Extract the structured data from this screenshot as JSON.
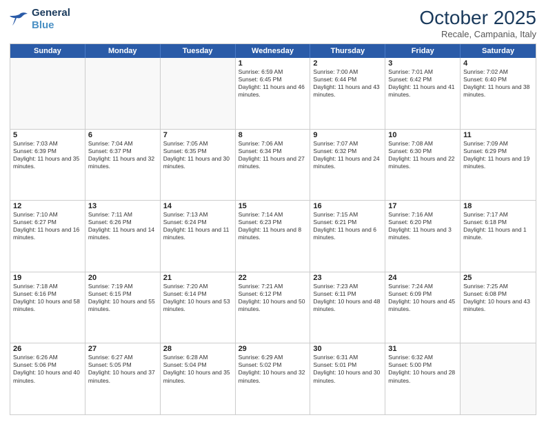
{
  "header": {
    "logo_line1": "General",
    "logo_line2": "Blue",
    "month": "October 2025",
    "location": "Recale, Campania, Italy"
  },
  "days_of_week": [
    "Sunday",
    "Monday",
    "Tuesday",
    "Wednesday",
    "Thursday",
    "Friday",
    "Saturday"
  ],
  "weeks": [
    [
      {
        "day": "",
        "text": ""
      },
      {
        "day": "",
        "text": ""
      },
      {
        "day": "",
        "text": ""
      },
      {
        "day": "1",
        "text": "Sunrise: 6:59 AM\nSunset: 6:45 PM\nDaylight: 11 hours and 46 minutes."
      },
      {
        "day": "2",
        "text": "Sunrise: 7:00 AM\nSunset: 6:44 PM\nDaylight: 11 hours and 43 minutes."
      },
      {
        "day": "3",
        "text": "Sunrise: 7:01 AM\nSunset: 6:42 PM\nDaylight: 11 hours and 41 minutes."
      },
      {
        "day": "4",
        "text": "Sunrise: 7:02 AM\nSunset: 6:40 PM\nDaylight: 11 hours and 38 minutes."
      }
    ],
    [
      {
        "day": "5",
        "text": "Sunrise: 7:03 AM\nSunset: 6:39 PM\nDaylight: 11 hours and 35 minutes."
      },
      {
        "day": "6",
        "text": "Sunrise: 7:04 AM\nSunset: 6:37 PM\nDaylight: 11 hours and 32 minutes."
      },
      {
        "day": "7",
        "text": "Sunrise: 7:05 AM\nSunset: 6:35 PM\nDaylight: 11 hours and 30 minutes."
      },
      {
        "day": "8",
        "text": "Sunrise: 7:06 AM\nSunset: 6:34 PM\nDaylight: 11 hours and 27 minutes."
      },
      {
        "day": "9",
        "text": "Sunrise: 7:07 AM\nSunset: 6:32 PM\nDaylight: 11 hours and 24 minutes."
      },
      {
        "day": "10",
        "text": "Sunrise: 7:08 AM\nSunset: 6:30 PM\nDaylight: 11 hours and 22 minutes."
      },
      {
        "day": "11",
        "text": "Sunrise: 7:09 AM\nSunset: 6:29 PM\nDaylight: 11 hours and 19 minutes."
      }
    ],
    [
      {
        "day": "12",
        "text": "Sunrise: 7:10 AM\nSunset: 6:27 PM\nDaylight: 11 hours and 16 minutes."
      },
      {
        "day": "13",
        "text": "Sunrise: 7:11 AM\nSunset: 6:26 PM\nDaylight: 11 hours and 14 minutes."
      },
      {
        "day": "14",
        "text": "Sunrise: 7:13 AM\nSunset: 6:24 PM\nDaylight: 11 hours and 11 minutes."
      },
      {
        "day": "15",
        "text": "Sunrise: 7:14 AM\nSunset: 6:23 PM\nDaylight: 11 hours and 8 minutes."
      },
      {
        "day": "16",
        "text": "Sunrise: 7:15 AM\nSunset: 6:21 PM\nDaylight: 11 hours and 6 minutes."
      },
      {
        "day": "17",
        "text": "Sunrise: 7:16 AM\nSunset: 6:20 PM\nDaylight: 11 hours and 3 minutes."
      },
      {
        "day": "18",
        "text": "Sunrise: 7:17 AM\nSunset: 6:18 PM\nDaylight: 11 hours and 1 minute."
      }
    ],
    [
      {
        "day": "19",
        "text": "Sunrise: 7:18 AM\nSunset: 6:16 PM\nDaylight: 10 hours and 58 minutes."
      },
      {
        "day": "20",
        "text": "Sunrise: 7:19 AM\nSunset: 6:15 PM\nDaylight: 10 hours and 55 minutes."
      },
      {
        "day": "21",
        "text": "Sunrise: 7:20 AM\nSunset: 6:14 PM\nDaylight: 10 hours and 53 minutes."
      },
      {
        "day": "22",
        "text": "Sunrise: 7:21 AM\nSunset: 6:12 PM\nDaylight: 10 hours and 50 minutes."
      },
      {
        "day": "23",
        "text": "Sunrise: 7:23 AM\nSunset: 6:11 PM\nDaylight: 10 hours and 48 minutes."
      },
      {
        "day": "24",
        "text": "Sunrise: 7:24 AM\nSunset: 6:09 PM\nDaylight: 10 hours and 45 minutes."
      },
      {
        "day": "25",
        "text": "Sunrise: 7:25 AM\nSunset: 6:08 PM\nDaylight: 10 hours and 43 minutes."
      }
    ],
    [
      {
        "day": "26",
        "text": "Sunrise: 6:26 AM\nSunset: 5:06 PM\nDaylight: 10 hours and 40 minutes."
      },
      {
        "day": "27",
        "text": "Sunrise: 6:27 AM\nSunset: 5:05 PM\nDaylight: 10 hours and 37 minutes."
      },
      {
        "day": "28",
        "text": "Sunrise: 6:28 AM\nSunset: 5:04 PM\nDaylight: 10 hours and 35 minutes."
      },
      {
        "day": "29",
        "text": "Sunrise: 6:29 AM\nSunset: 5:02 PM\nDaylight: 10 hours and 32 minutes."
      },
      {
        "day": "30",
        "text": "Sunrise: 6:31 AM\nSunset: 5:01 PM\nDaylight: 10 hours and 30 minutes."
      },
      {
        "day": "31",
        "text": "Sunrise: 6:32 AM\nSunset: 5:00 PM\nDaylight: 10 hours and 28 minutes."
      },
      {
        "day": "",
        "text": ""
      }
    ]
  ]
}
